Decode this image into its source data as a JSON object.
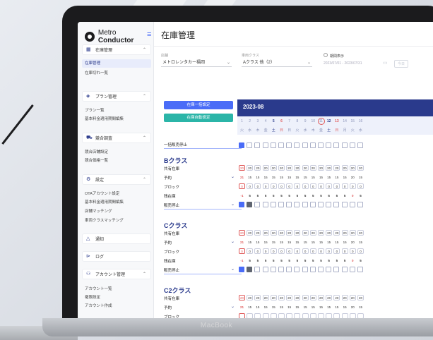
{
  "brand": {
    "name_regular": "Metro ",
    "name_bold": "Conductor"
  },
  "page_title": "在庫管理",
  "sidebar": {
    "sections": [
      {
        "label": "在庫管理",
        "icon": "grid-icon",
        "subs": [
          "在庫管理",
          "在庫切れ一覧"
        ]
      },
      {
        "label": "プラン管理",
        "icon": "tag-icon",
        "subs": [
          "プラン一覧",
          "基本料金適用期間編集"
        ]
      },
      {
        "label": "競合調査",
        "icon": "car-icon",
        "subs": [
          "競合店舗設定",
          "競合価格一覧"
        ]
      },
      {
        "label": "設定",
        "icon": "gear-icon",
        "subs": [
          "OTAアカウント設定",
          "基本料金適用期間編集",
          "店舗マッチング",
          "車両クラスマッチング"
        ]
      },
      {
        "label": "通知",
        "icon": "bell-icon",
        "subs": []
      },
      {
        "label": "ログ",
        "icon": "log-icon",
        "subs": []
      },
      {
        "label": "アカウント管理",
        "icon": "user-icon",
        "subs": [
          "アカウント一覧",
          "権限設定",
          "アカウント作成"
        ]
      }
    ]
  },
  "filters": {
    "store_label": "店舗",
    "store_value": "メトロレンタカー福岡",
    "class_label": "車両クラス",
    "class_value": "Aクラス 他（2）",
    "period_label": "期間表示",
    "period_value": "2023/07/01 - 2023/07/31",
    "today_label": "今日"
  },
  "buttons": {
    "bulk_set": "在庫一括設定",
    "auto_set": "在庫自動設定"
  },
  "calendar": {
    "month": "2023-08",
    "dates": [
      "1",
      "2",
      "3",
      "4",
      "5",
      "6",
      "7",
      "8",
      "9",
      "10",
      "11",
      "12",
      "13",
      "14",
      "15",
      "16"
    ],
    "weekdays": [
      "火",
      "水",
      "木",
      "金",
      "土",
      "日",
      "日",
      "火",
      "水",
      "木",
      "金",
      "土",
      "日",
      "月",
      "火",
      "水"
    ],
    "sat_indices": [
      4,
      11
    ],
    "sun_indices": [
      5,
      12
    ],
    "today_index": 10
  },
  "bulk_stop_label": "一括販売停止",
  "row_labels": {
    "shared": "共有在庫",
    "reserved": "予約",
    "block": "ブロック",
    "remaining": "残在庫",
    "stop": "販売停止"
  },
  "classes": [
    {
      "name": "Bクラス",
      "shared": "20",
      "reserved": [
        "21",
        "15",
        "15",
        "15",
        "15",
        "15",
        "15",
        "15",
        "15",
        "15",
        "15",
        "15",
        "15",
        "15",
        "20",
        "15"
      ],
      "block": "0",
      "remaining": [
        "-1",
        "5",
        "5",
        "5",
        "5",
        "5",
        "5",
        "5",
        "5",
        "5",
        "5",
        "5",
        "5",
        "5",
        "0",
        "5"
      ]
    },
    {
      "name": "Cクラス",
      "shared": "20",
      "reserved": [
        "21",
        "15",
        "15",
        "15",
        "15",
        "15",
        "15",
        "15",
        "15",
        "15",
        "15",
        "15",
        "15",
        "15",
        "20",
        "15"
      ],
      "block": "0",
      "remaining": [
        "-1",
        "5",
        "5",
        "5",
        "5",
        "5",
        "5",
        "5",
        "5",
        "5",
        "5",
        "5",
        "5",
        "5",
        "0",
        "5"
      ]
    },
    {
      "name": "C2クラス",
      "shared": "20",
      "reserved": [
        "21",
        "15",
        "15",
        "15",
        "15",
        "15",
        "15",
        "15",
        "15",
        "15",
        "15",
        "15",
        "15",
        "15",
        "20",
        "15"
      ]
    }
  ],
  "device_label": "MacBook",
  "colors": {
    "accent": "#4a6cf7",
    "navy": "#2a3a8c",
    "teal": "#2bb5a8",
    "alert": "#e05a5a"
  }
}
